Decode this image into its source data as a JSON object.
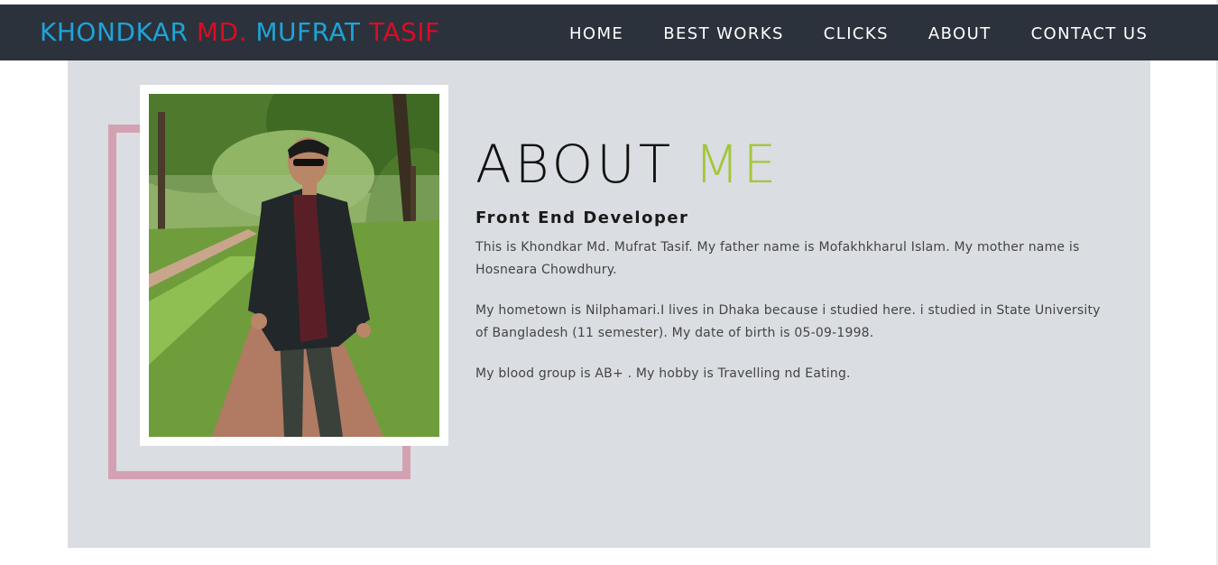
{
  "brand": {
    "part1": "KHONDKAR ",
    "part2": "MD. ",
    "part3": "MUFRAT ",
    "part4": "TASIF"
  },
  "nav": {
    "items": [
      {
        "label": "HOME"
      },
      {
        "label": "BEST WORKS"
      },
      {
        "label": "CLICKS"
      },
      {
        "label": "ABOUT"
      },
      {
        "label": "CONTACT US"
      }
    ]
  },
  "about": {
    "heading_main": "ABOUT ",
    "heading_accent": "ME",
    "subtitle": "Front End Developer",
    "paragraphs": [
      "This is Khondkar Md. Mufrat Tasif. My father name is Mofakhkharul Islam. My mother name is Hosneara Chowdhury.",
      "My hometown is Nilphamari.I lives in Dhaka because i studied here. i studied in State University of Bangladesh (11 semester). My date of birth is 05-09-1998.",
      "My blood group is AB+ . My hobby is Travelling nd Eating."
    ]
  },
  "colors": {
    "navbar": "#2b323c",
    "brand_blue": "#1fa3d6",
    "brand_red": "#d80d25",
    "accent_green": "#a4c639",
    "section_bg": "#dadde2",
    "frame_pink": "#d4a1b3"
  }
}
